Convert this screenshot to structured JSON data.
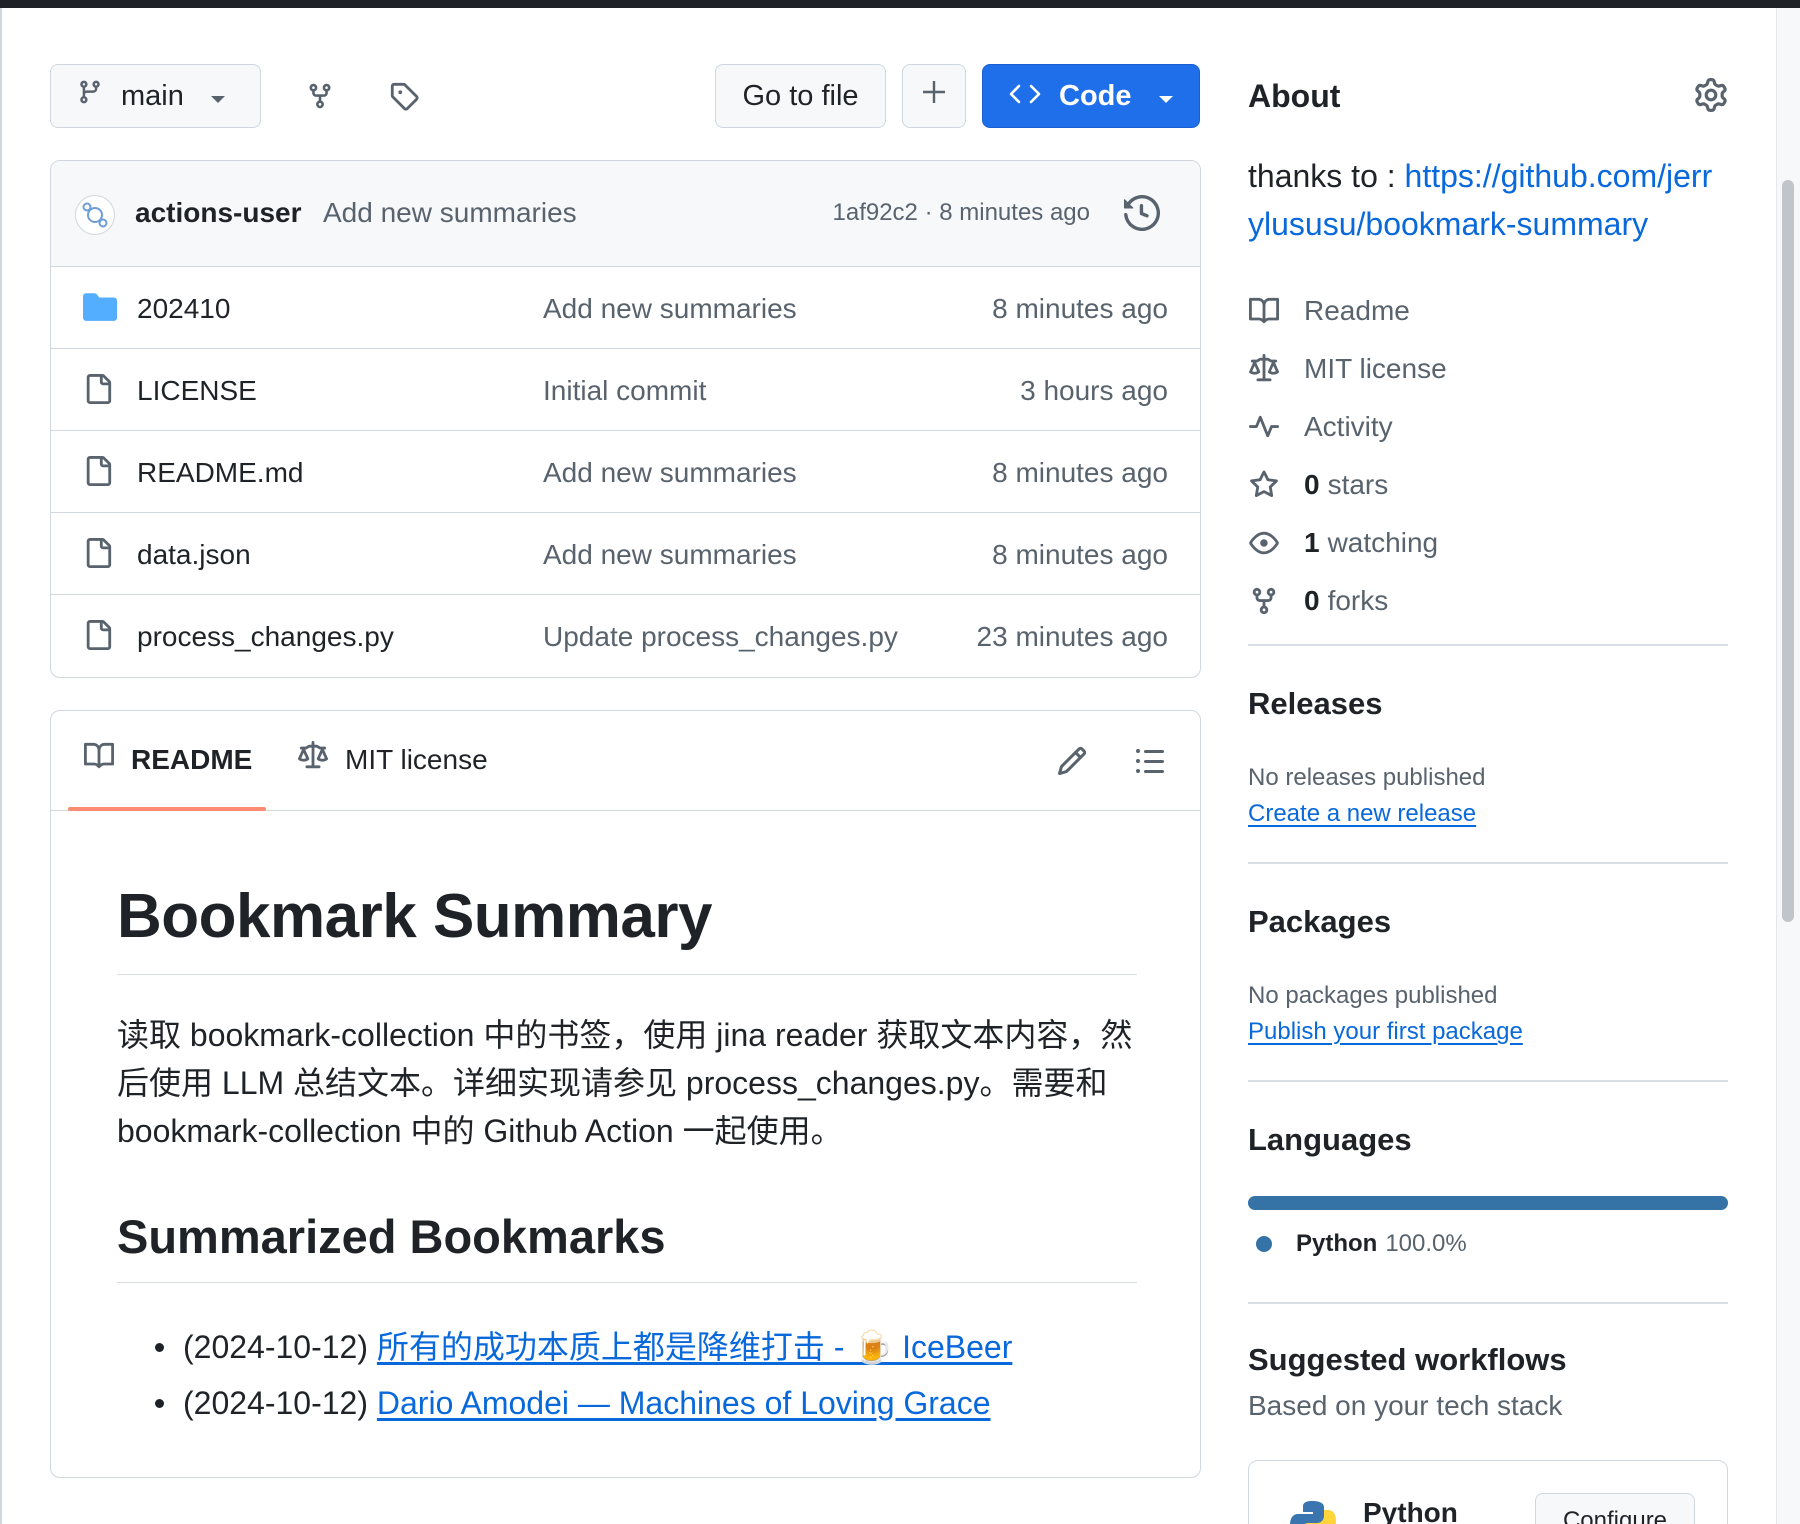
{
  "toolbar": {
    "branch": "main",
    "go_to_file": "Go to file",
    "code_label": "Code"
  },
  "commit": {
    "author": "actions-user",
    "message": "Add new summaries",
    "meta": "1af92c2 · 8 minutes ago"
  },
  "files": [
    {
      "type": "folder",
      "name": "202410",
      "message": "Add new summaries",
      "time": "8 minutes ago"
    },
    {
      "type": "file",
      "name": "LICENSE",
      "message": "Initial commit",
      "time": "3 hours ago"
    },
    {
      "type": "file",
      "name": "README.md",
      "message": "Add new summaries",
      "time": "8 minutes ago"
    },
    {
      "type": "file",
      "name": "data.json",
      "message": "Add new summaries",
      "time": "8 minutes ago"
    },
    {
      "type": "file",
      "name": "process_changes.py",
      "message": "Update process_changes.py",
      "time": "23 minutes ago"
    }
  ],
  "readme": {
    "tab_readme": "README",
    "tab_license": "MIT license",
    "title": "Bookmark Summary",
    "intro": "读取 bookmark-collection 中的书签，使用 jina reader 获取文本内容，然后使用 LLM 总结文本。详细实现请参见 process_changes.py。需要和 bookmark-collection 中的 Github Action 一起使用。",
    "section_title": "Summarized Bookmarks",
    "bookmarks": [
      {
        "date": "(2024-10-12)",
        "title": "所有的成功本质上都是降维打击 - 🍺 IceBeer"
      },
      {
        "date": "(2024-10-12)",
        "title": "Dario Amodei — Machines of Loving Grace"
      }
    ]
  },
  "about": {
    "heading": "About",
    "desc_prefix": "thanks to : ",
    "desc_link": "https://github.com/jerrylususu/bookmark-summary",
    "items": {
      "readme": "Readme",
      "license": "MIT license",
      "activity": "Activity",
      "stars_count": "0",
      "stars_label": "stars",
      "watching_count": "1",
      "watching_label": "watching",
      "forks_count": "0",
      "forks_label": "forks"
    }
  },
  "releases": {
    "heading": "Releases",
    "empty": "No releases published",
    "link": "Create a new release"
  },
  "packages": {
    "heading": "Packages",
    "empty": "No packages published",
    "link": "Publish your first package"
  },
  "languages": {
    "heading": "Languages",
    "items": [
      {
        "name": "Python",
        "percent": "100.0%",
        "color": "#3572a5"
      }
    ]
  },
  "workflows": {
    "heading": "Suggested workflows",
    "subheading": "Based on your tech stack",
    "card_name": "Python",
    "card_button": "Configure"
  },
  "colors": {
    "accent": "#1f6feb",
    "link": "#0969da",
    "folder": "#54aeff",
    "tab_underline": "#fd8c73"
  }
}
